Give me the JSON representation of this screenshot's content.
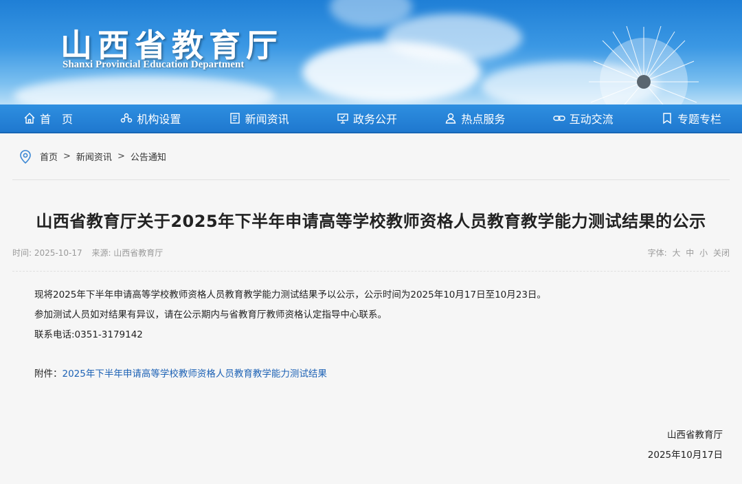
{
  "banner": {
    "title_cn": "山西省教育厅",
    "title_en": "Shanxi Provincial Education Department"
  },
  "nav": {
    "items": [
      {
        "label": "首　页",
        "icon": "home-icon"
      },
      {
        "label": "机构设置",
        "icon": "org-icon"
      },
      {
        "label": "新闻资讯",
        "icon": "news-icon"
      },
      {
        "label": "政务公开",
        "icon": "government-icon"
      },
      {
        "label": "热点服务",
        "icon": "service-icon"
      },
      {
        "label": "互动交流",
        "icon": "link-icon"
      },
      {
        "label": "专题专栏",
        "icon": "bookmark-icon"
      }
    ]
  },
  "breadcrumb": {
    "home": "首页",
    "sep": ">",
    "level1": "新闻资讯",
    "level2": "公告通知"
  },
  "article": {
    "title": "山西省教育厅关于2025年下半年申请高等学校教师资格人员教育教学能力测试结果的公示",
    "time": "时间: 2025-10-17",
    "source": "来源: 山西省教育厅",
    "font_label": "字体:",
    "font_large": "大",
    "font_medium": "中",
    "font_small": "小",
    "close": "关闭",
    "para1": "现将2025年下半年申请高等学校教师资格人员教育教学能力测试结果予以公示，公示时间为2025年10月17日至10月23日。",
    "para2": "参加测试人员如对结果有异议，请在公示期内与省教育厅教师资格认定指导中心联系。",
    "para3": "联系电话:0351-3179142",
    "attach_label": "附件：",
    "attach_link": "2025年下半年申请高等学校教师资格人员教育教学能力测试结果",
    "sign_org": "山西省教育厅",
    "sign_date": "2025年10月17日"
  },
  "colors": {
    "nav_bg": "#2482d8",
    "link": "#1d62b5"
  }
}
